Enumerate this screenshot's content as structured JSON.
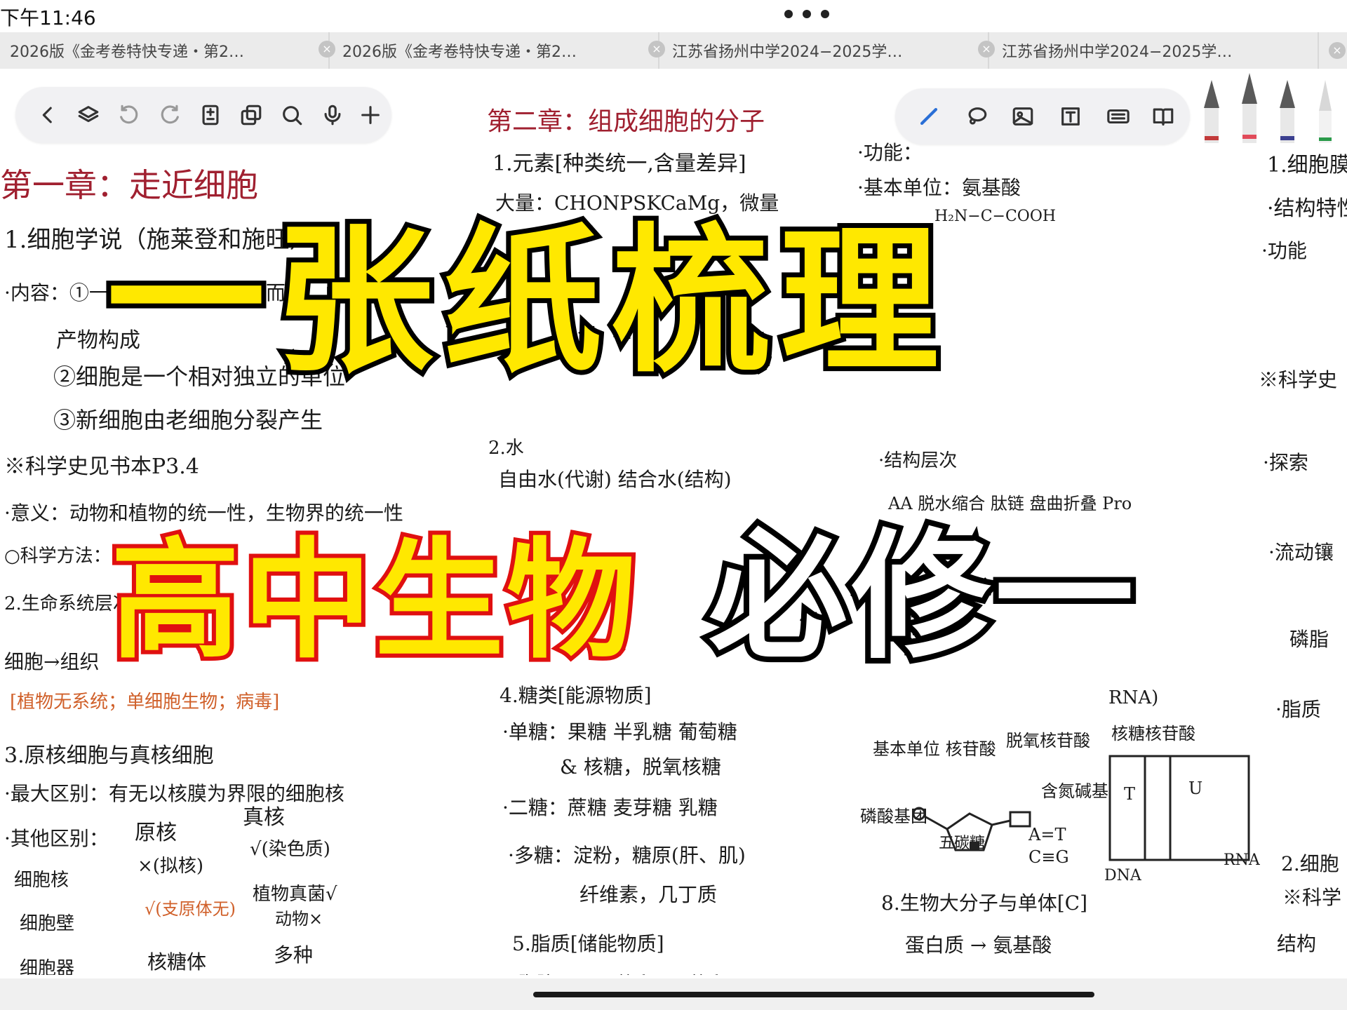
{
  "status_bar": {
    "time": "下午11:46"
  },
  "tabs": [
    {
      "label": "2026版《金考卷特快专递・第2…"
    },
    {
      "label": "2026版《金考卷特快专递・第2…"
    },
    {
      "label": "江苏省扬州中学2024−2025学…"
    },
    {
      "label": "江苏省扬州中学2024−2025学…"
    }
  ],
  "toolbar_left": {
    "icons": [
      "back-icon",
      "layers-icon",
      "undo-icon",
      "redo-icon",
      "page-icon",
      "copy-icon",
      "search-icon",
      "mic-icon",
      "add-icon"
    ]
  },
  "toolbar_right": {
    "icons": [
      "pen-icon",
      "lasso-icon",
      "image-icon",
      "text-box-icon",
      "keyboard-icon",
      "book-icon"
    ]
  },
  "pens": {
    "colors": [
      "#c23a3a",
      "#e14b5a",
      "#3b3f8f",
      "#2a9a4a"
    ]
  },
  "notes": {
    "left": [
      "第一章：走近细胞",
      "1.细胞学说（施莱登和施旺）",
      "·内容：①一切动植物都由细胞而来，由细胞",
      "产物构成",
      "②细胞是一个相对独立的单位",
      "③新细胞由老细胞分裂产生",
      "※科学史见书本P3.4",
      "·意义：动物和植物的统一性，生物界的统一性",
      "○科学方法：",
      "2.生命系统层次",
      "细胞→组织",
      "[植物无系统；单细胞生物；病毒]",
      "3.原核细胞与真核细胞",
      "·最大区别：有无以核膜为界限的细胞核",
      "·其他区别：",
      "原核",
      "真核",
      "细胞核",
      "×(拟核)",
      "√(染色质)",
      "细胞壁",
      "√(支原体无)",
      "植物真菌√",
      "动物×",
      "细胞器",
      "核糖体",
      "多种"
    ],
    "middle": [
      "第二章：组成细胞的分子",
      "1.元素[种类统一,含量差异]",
      "大量：CHONPSKCaMg，微量",
      "2.水",
      "自由水(代谢) 结合水(结构)",
      "4.糖类[能源物质]",
      "·单糖：果糖 半乳糖 葡萄糖",
      "& 核糖，脱氧核糖",
      "·二糖：蔗糖 麦芽糖 乳糖",
      "·多糖：淀粉，糖原(肝、肌)",
      "纤维素，几丁质",
      "5.脂质[储能物质]",
      "·脂肪 CHO (饱和、不饱和)"
    ],
    "right": [
      "·功能：",
      "·基本单位：氨基酸",
      "H₂N−C−COOH",
      "·结构层次",
      "AA 脱水缩合 肽链 盘曲折叠 Pro",
      "RNA)",
      "基本单位 核苷酸",
      "脱氧核苷酸",
      "核糖核苷酸",
      "磷酸基团",
      "五碳糖",
      "含氮碱基",
      "A=T",
      "C≡G",
      "T",
      "U",
      "DNA",
      "RNA",
      "8.生物大分子与单体[C]",
      "蛋白质 → 氨基酸"
    ],
    "far_right": [
      "1.细胞膜",
      "·结构特性",
      "·功能",
      "※科学史",
      "·探索",
      "·流动镶",
      "磷脂",
      "·脂质",
      "2.细胞",
      "※科学",
      "结构"
    ]
  },
  "overlay": {
    "title_main": "一张纸梳理",
    "title_subject": "高中生物",
    "title_volume": "必修一"
  }
}
